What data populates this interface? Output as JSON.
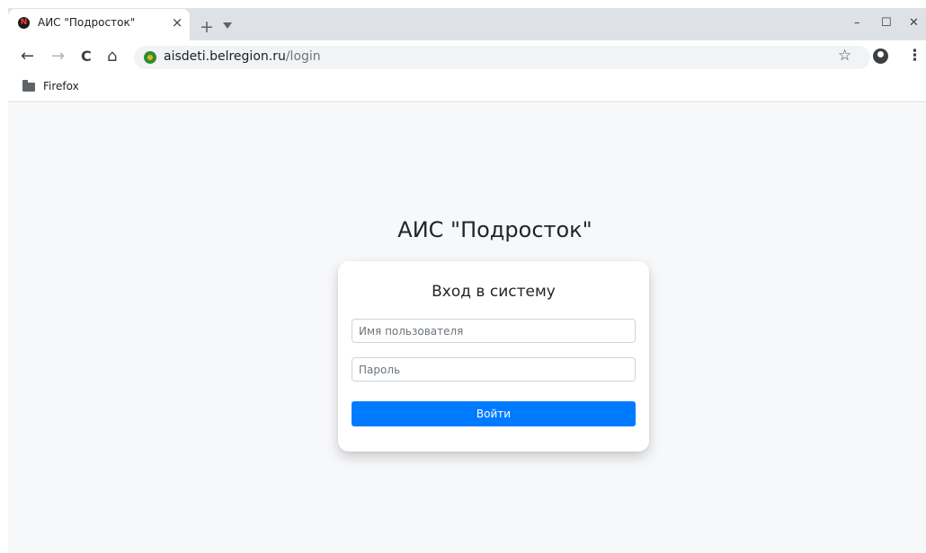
{
  "browser": {
    "tab": {
      "favicon": "N",
      "title": "АИС \"Подросток\"",
      "close": "×"
    },
    "new_tab": "+",
    "window_controls": {
      "minimize": "–",
      "maximize": "☐",
      "close": "✕"
    },
    "nav": {
      "back": "←",
      "forward": "→",
      "reload": "C",
      "home": "⌂"
    },
    "address": {
      "host": "aisdeti.belregion.ru",
      "path": "/login"
    },
    "bookmark_star": "☆",
    "menu": "⋮",
    "bookmarks": [
      {
        "label": "Firefox",
        "icon": "folder-icon"
      }
    ]
  },
  "page": {
    "app_title": "АИС \"Подросток\"",
    "login": {
      "title": "Вход в систему",
      "username_placeholder": "Имя пользователя",
      "password_placeholder": "Пароль",
      "submit_label": "Войти"
    }
  },
  "colors": {
    "primary_button": "#007bff",
    "page_background": "#f7f8fa",
    "tabstrip": "#dee1e6"
  }
}
